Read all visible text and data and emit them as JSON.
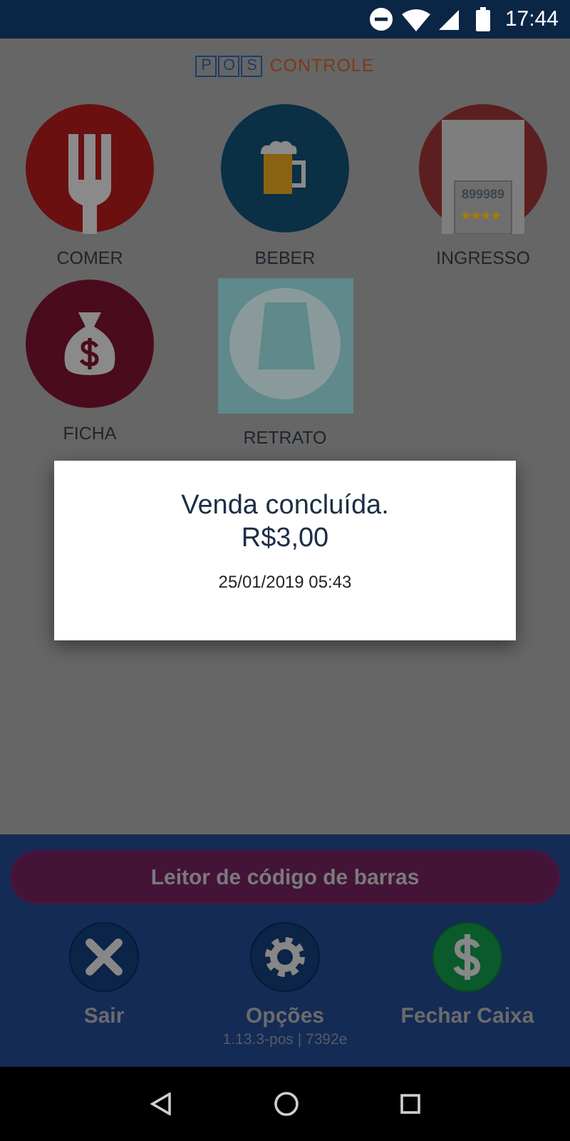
{
  "status_bar": {
    "time": "17:44"
  },
  "logo": {
    "boxed_letters": [
      "P",
      "O",
      "S"
    ],
    "text": "CONTROLE"
  },
  "categories": [
    {
      "label": "COMER",
      "kind": "fork"
    },
    {
      "label": "BEBER",
      "kind": "beer"
    },
    {
      "label": "INGRESSO",
      "kind": "ticket",
      "ticket_number": "899989"
    },
    {
      "label": "FICHA",
      "kind": "money"
    },
    {
      "label": "RETRATO",
      "kind": "picture"
    }
  ],
  "dialog": {
    "title": "Venda concluída.",
    "amount": "R$3,00",
    "date": "25/01/2019 05:43"
  },
  "scanner_button": {
    "label": "Leitor de código de barras"
  },
  "actions": [
    {
      "label": "Sair",
      "kind": "close"
    },
    {
      "label": "Opções",
      "kind": "settings"
    },
    {
      "label": "Fechar Caixa",
      "kind": "money"
    }
  ],
  "version": "1.13.3-pos | 7392e"
}
